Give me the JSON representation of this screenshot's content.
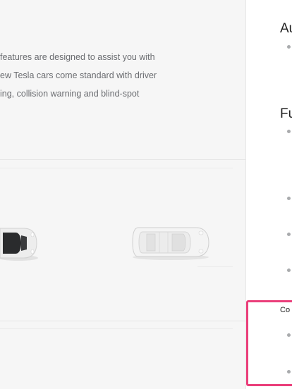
{
  "intro": {
    "lines": [
      " features are designed to assist you with",
      "ew Tesla cars come standard with driver",
      "ing, collision warning and blind-spot"
    ]
  },
  "sidebar": {
    "heading_1": "Au",
    "heading_2": "Fu",
    "subheading": "Co"
  },
  "colors": {
    "highlight": "#ea3e7a",
    "background": "#f6f6f6",
    "text": "#5c5e62"
  }
}
